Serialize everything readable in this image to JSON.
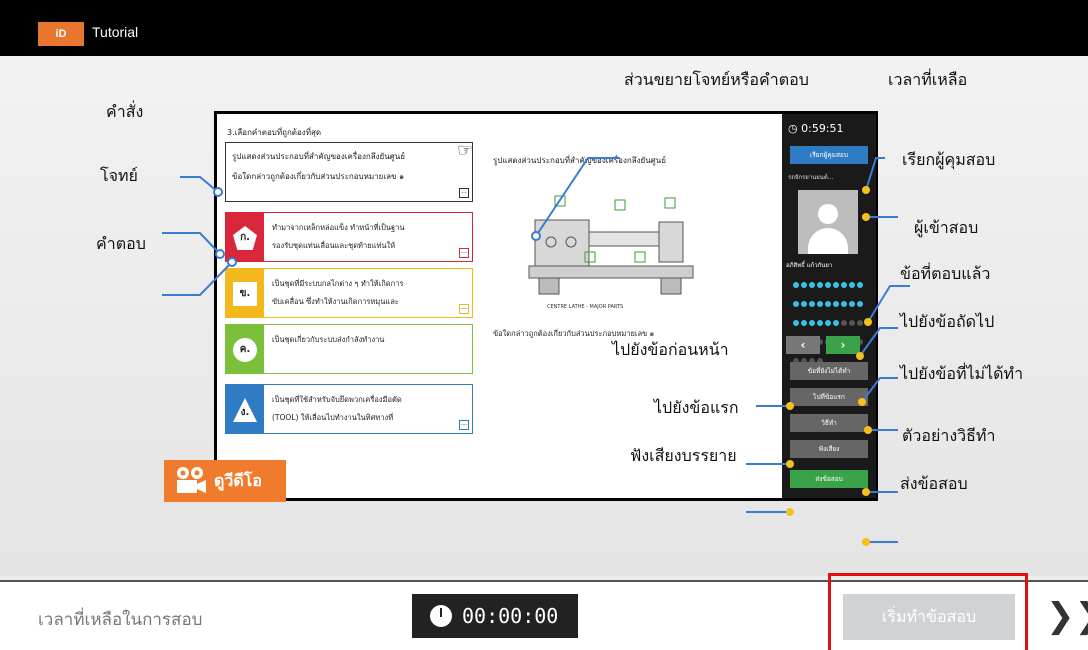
{
  "app": {
    "logo_text": "iD",
    "title": "Tutorial"
  },
  "exam": {
    "question_title": "3.เลือกคำตอบที่ถูกต้องที่สุด",
    "question_lines": [
      "รูปแสดงส่วนประกอบที่สำคัญของเครื่องกลึงยันศูนย์",
      "ข้อใดกล่าวถูกต้องเกี่ยวกับส่วนประกอบหมายเลข ๑"
    ],
    "answers": [
      {
        "mark": "ก.",
        "color": "#d9263b",
        "line1": "ทำมาจากเหล็กหล่อแข็ง ทำหน้าที่เป็นฐาน",
        "line2": "รองรับชุดแท่นเลื่อนและชุดท้ายแท่นให้"
      },
      {
        "mark": "ข.",
        "color": "#f3b81c",
        "line1": "เป็นชุดที่มีระบบกลไกต่าง ๆ ทำให้เกิดการ",
        "line2": "ขับเคลื่อน ซึ่งทำให้งานเกิดการหมุนและ"
      },
      {
        "mark": "ค.",
        "color": "#7cbf3a",
        "line1": "เป็นชุดเกี่ยวกับระบบส่งกำลังทำงาน",
        "line2": ""
      },
      {
        "mark": "ง.",
        "color": "#2f7bc4",
        "line1": "เป็นชุดที่ใช้สำหรับจับยึดพวกเครื่องมือตัด",
        "line2": "(TOOL) ให้เลื่อนไปทำงานในทิศทางที่"
      }
    ],
    "preview_title": "รูปแสดงส่วนประกอบที่สำคัญของเครื่องกลึงยันศูนย์",
    "machine_label": "CENTRE LATHE - MAJOR PARTS",
    "preview_question": "ข้อใดกล่าวถูกต้องเกี่ยวกับส่วนประกอบหมายเลข ๑",
    "side": {
      "timer": "0:59:51",
      "call_proctor": "เรียกผู้คุมสอบ",
      "exam_title": "รถจักรยานยนต์...",
      "candidate_name": "อภิสิทธิ์ แก้วกันยา",
      "unanswered": "ข้อที่ยังไม่ได้ทำ",
      "first": "ไปที่ข้อแรก",
      "howto": "วิธีทำ",
      "listen": "ฟังเสียง",
      "submit": "ส่งข้อสอบ"
    }
  },
  "callouts": {
    "command": "คำสั่ง",
    "question": "โจทย์",
    "answer": "คำตอบ",
    "zoom": "ส่วนขยายโจทย์หรือคำตอบ",
    "time_left": "เวลาที่เหลือ",
    "call_proctor": "เรียกผู้คุมสอบ",
    "candidate": "ผู้เข้าสอบ",
    "answered": "ข้อที่ตอบแล้ว",
    "next": "ไปยังข้อถัดไป",
    "prev": "ไปยังข้อก่อนหน้า",
    "unanswered": "ไปยังข้อที่ไม่ได้ทำ",
    "first": "ไปยังข้อแรก",
    "example": "ตัวอย่างวิธีทำ",
    "listen": "ฟังเสียงบรรยาย",
    "submit": "ส่งข้อสอบ"
  },
  "video_button": "ดูวีดีโอ",
  "footer": {
    "time_label": "เวลาที่เหลือในการสอบ",
    "clock": "00:00:00",
    "start_button": "เริ่มทำข้อสอบ",
    "next_arrow": "❯❯"
  },
  "colors": {
    "accent_orange": "#f07b2c",
    "callout_line": "#3a7bd5",
    "dot_yellow": "#f3c11c",
    "highlight_red": "#e01010"
  }
}
